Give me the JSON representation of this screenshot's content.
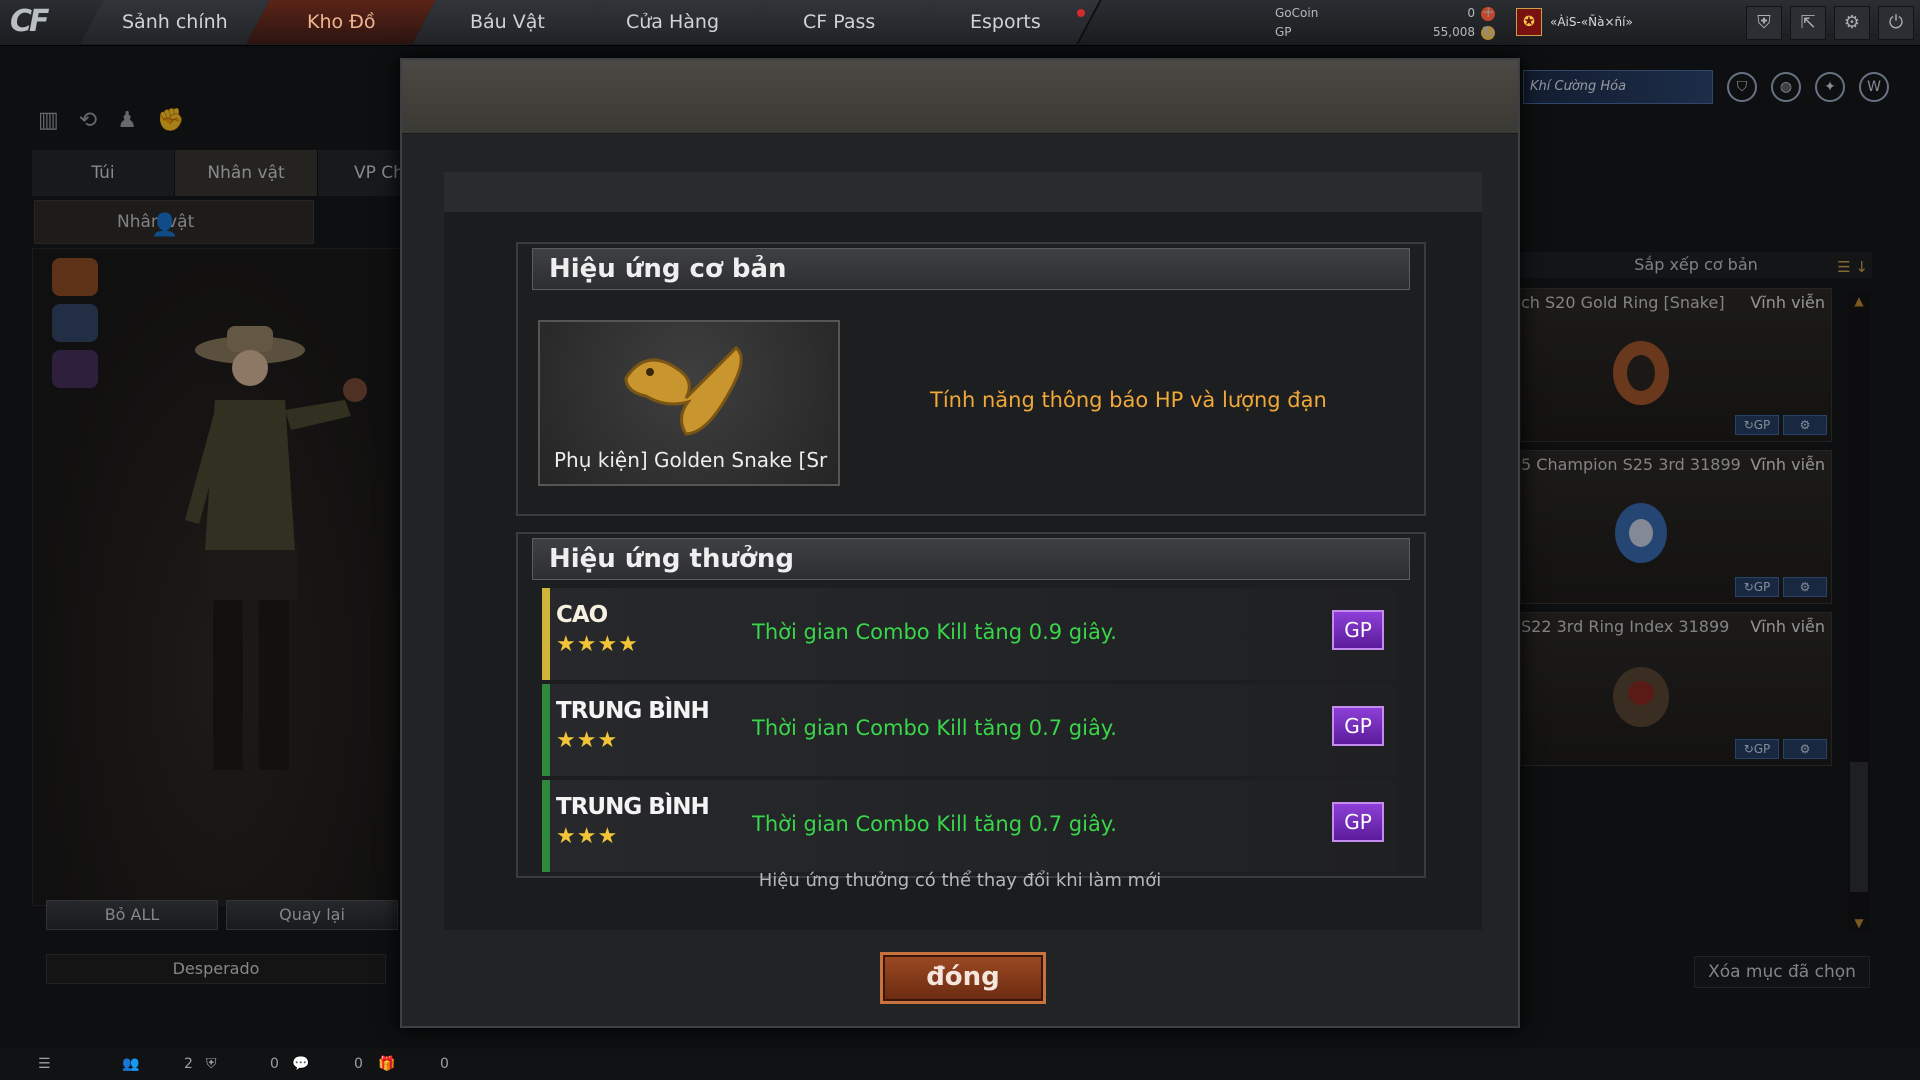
{
  "nav": {
    "logo": "CF",
    "items": [
      "Sảnh chính",
      "Kho Đồ",
      "Báu Vật",
      "Cửa Hàng",
      "CF Pass",
      "Esports"
    ]
  },
  "currency": {
    "gocoin_label": "GoCoin",
    "gocoin_value": "0",
    "gp_label": "GP",
    "gp_value": "55,008"
  },
  "user": {
    "name": "«ÀiS‑«Ñà×ñí»"
  },
  "left": {
    "tabs": [
      "Túi",
      "Nhân vật",
      "VP Chức"
    ],
    "subtab": "Nhân vật",
    "buttons": {
      "drop_all": "Bỏ ALL",
      "back": "Quay lại"
    },
    "character_name": "Desperado"
  },
  "right": {
    "banner": "Khí Cường Hóa",
    "sort_label": "Sắp xếp cơ bản",
    "items": [
      {
        "title": "ch S20 Gold Ring [Snake]",
        "period": "Vĩnh viễn"
      },
      {
        "title": "5 Champion S25 3rd 31899",
        "period": "Vĩnh viễn"
      },
      {
        "title": "S22 3rd Ring Index 31899",
        "period": "Vĩnh viễn"
      }
    ],
    "clear_selected": "Xóa mục đã chọn"
  },
  "status": {
    "count1": "2",
    "count2": "0",
    "count3": "0",
    "count4": "0"
  },
  "modal": {
    "basic_title": "Hiệu ứng cơ bản",
    "item_name": "Phụ kiện] Golden Snake [Sr",
    "basic_effect": "Tính năng thông báo HP và lượng đạn",
    "bonus_title": "Hiệu ứng thưởng",
    "effects": [
      {
        "tier": "CAO",
        "stars": "★★★★",
        "text": "Thời gian Combo Kill tăng 0.9 giây.",
        "refresh": "GP"
      },
      {
        "tier": "TRUNG BÌNH",
        "stars": "★★★",
        "text": "Thời gian Combo Kill tăng 0.7 giây.",
        "refresh": "GP"
      },
      {
        "tier": "TRUNG BÌNH",
        "stars": "★★★",
        "text": "Thời gian Combo Kill tăng 0.7 giây.",
        "refresh": "GP"
      }
    ],
    "hint": "Hiệu ứng thưởng có thể thay đổi khi làm mới",
    "close": "đóng"
  },
  "colors": {
    "basic_effect": "#f0a838",
    "bonus_effect": "#39d64a",
    "tier_high": "#d1b43a",
    "tier_mid": "#2e8a3a"
  }
}
